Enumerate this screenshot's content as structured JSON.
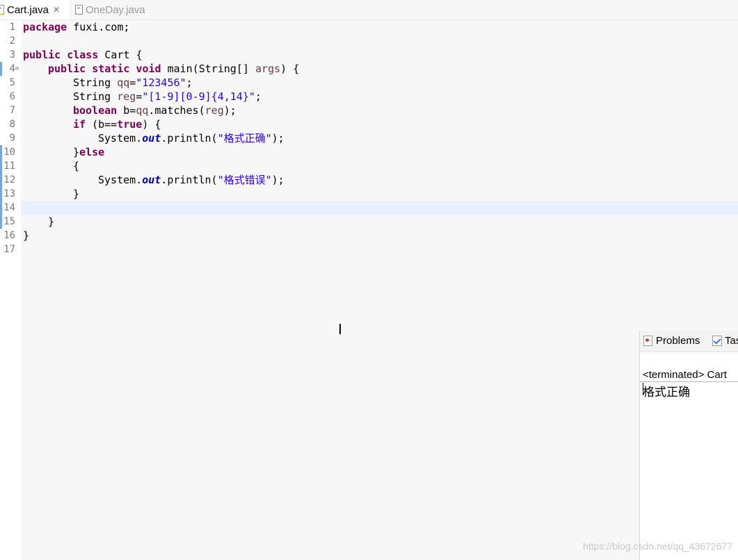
{
  "tabs": {
    "active": {
      "label": "Cart.java"
    },
    "inactive": {
      "label": "OneDay.java"
    }
  },
  "editor": {
    "line_numbers": [
      "1",
      "2",
      "3",
      "4",
      "5",
      "6",
      "7",
      "8",
      "9",
      "10",
      "11",
      "12",
      "13",
      "14",
      "15",
      "16",
      "17"
    ],
    "code": {
      "l1_kw": "package",
      "l1_rest": " fuxi.com;",
      "l3_kw1": "public",
      "l3_kw2": "class",
      "l3_rest": " Cart {",
      "l4_kw1": "public",
      "l4_kw2": "static",
      "l4_kw3": "void",
      "l4_rest": " main(String[] ",
      "l4_var": "args",
      "l4_end": ") {",
      "l5_a": "String ",
      "l5_var": "qq",
      "l5_b": "=",
      "l5_str": "\"123456\"",
      "l5_c": ";",
      "l6_a": "String ",
      "l6_var": "reg",
      "l6_b": "=",
      "l6_str": "\"[1-9][0-9]{4,14}\"",
      "l6_c": ";",
      "l7_kw": "boolean",
      "l7_a": " b=",
      "l7_var1": "qq",
      "l7_b": ".matches(",
      "l7_var2": "reg",
      "l7_c": ");",
      "l8_kw": "if",
      "l8_a": " (b==",
      "l8_kw2": "true",
      "l8_b": ") {",
      "l9_a": "System.",
      "l9_fld": "out",
      "l9_b": ".println(",
      "l9_str": "\"格式正确\"",
      "l9_c": ");",
      "l10_a": "}",
      "l10_kw": "else",
      "l11_a": "{",
      "l12_a": "System.",
      "l12_fld": "out",
      "l12_b": ".println(",
      "l12_str": "\"格式错误\"",
      "l12_c": ");",
      "l13_a": "}",
      "l15_a": "}",
      "l16_a": "}"
    }
  },
  "console": {
    "tab_problems": "Problems",
    "tab_tasks": "Tas",
    "header": "<terminated> Cart",
    "output": "格式正确"
  },
  "watermark": "https://blog.csdn.net/qq_43672677",
  "colors": {
    "keyword": "#7f0055",
    "string": "#2a00ff",
    "local_var": "#6a3e3e",
    "static_field": "#0000c0",
    "current_line": "#e8f2fe"
  }
}
